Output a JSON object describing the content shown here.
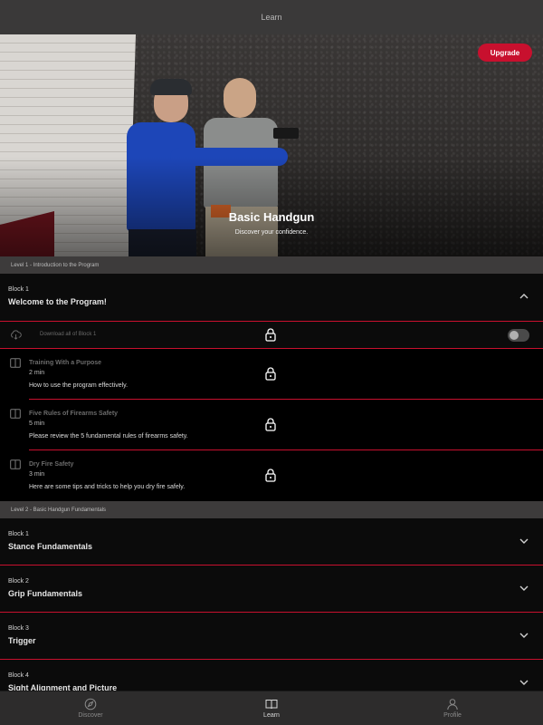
{
  "header": {
    "title": "Learn"
  },
  "hero": {
    "course_title": "Basic Handgun",
    "course_subtitle": "Discover your confidence.",
    "upgrade_label": "Upgrade"
  },
  "levels": [
    {
      "label": "Level 1 - Introduction to the Program"
    },
    {
      "label": "Level 2 - Basic Handgun Fundamentals"
    }
  ],
  "level1_block": {
    "number": "Block 1",
    "title": "Welcome to the Program!",
    "download_label": "Download all of Block 1",
    "download_toggle_on": false,
    "lessons": [
      {
        "title": "Training With a Purpose",
        "duration": "2 min",
        "description": "How to use  the program effectively."
      },
      {
        "title": "Five Rules of Firearms Safety",
        "duration": "5 min",
        "description": "Please review the 5 fundamental rules of firearms safety."
      },
      {
        "title": "Dry Fire Safety",
        "duration": "3 min",
        "description": "Here are some tips and tricks to help you dry fire safely."
      }
    ]
  },
  "level2_blocks": [
    {
      "number": "Block 1",
      "title": "Stance Fundamentals"
    },
    {
      "number": "Block 2",
      "title": "Grip Fundamentals"
    },
    {
      "number": "Block 3",
      "title": "Trigger"
    },
    {
      "number": "Block 4",
      "title": "Sight Alignment and Picture"
    }
  ],
  "bottom_nav": [
    {
      "label": "Discover",
      "icon": "compass-icon",
      "active": false
    },
    {
      "label": "Learn",
      "icon": "book-icon",
      "active": true
    },
    {
      "label": "Profile",
      "icon": "user-icon",
      "active": false
    }
  ],
  "colors": {
    "accent": "#c8102e",
    "background": "#000000",
    "bar": "#3a3939"
  }
}
